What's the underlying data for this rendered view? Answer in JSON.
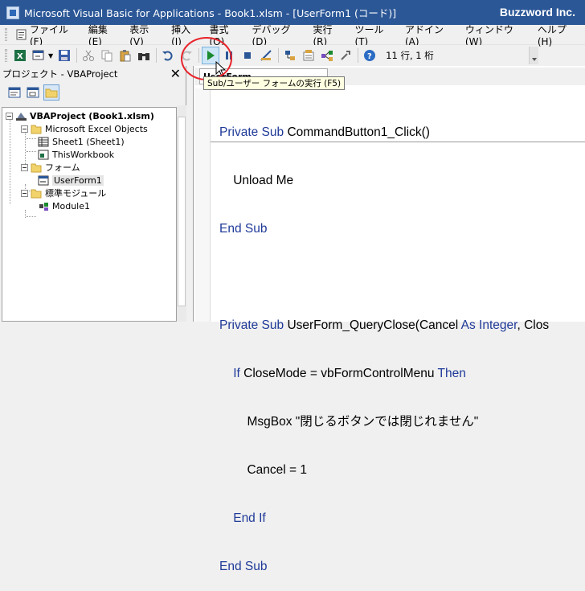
{
  "window": {
    "title": "Microsoft Visual Basic for Applications - Book1.xlsm - [UserForm1 (コード)]",
    "brand": "Buzzword Inc."
  },
  "menu": [
    {
      "label": "ファイル(F)",
      "icon": "vba-doc-icon"
    },
    {
      "label": "編集(E)",
      "icon": ""
    },
    {
      "label": "表示(V)",
      "icon": ""
    },
    {
      "label": "挿入(I)",
      "icon": ""
    },
    {
      "label": "書式(O)",
      "icon": ""
    },
    {
      "label": "デバッグ(D)",
      "icon": ""
    },
    {
      "label": "実行(R)",
      "icon": ""
    },
    {
      "label": "ツール(T)",
      "icon": ""
    },
    {
      "label": "アドイン(A)",
      "icon": ""
    },
    {
      "label": "ウィンドウ(W)",
      "icon": ""
    },
    {
      "label": "ヘルプ(H)",
      "icon": ""
    }
  ],
  "toolbar": {
    "position": "11 行, 1 桁",
    "run_tooltip": "Sub/ユーザー フォームの実行 (F5)"
  },
  "project_panel": {
    "title": "プロジェクト - VBAProject",
    "close": "✕",
    "tree": {
      "root": "VBAProject (Book1.xlsm)",
      "excel_objects": "Microsoft Excel Objects",
      "sheet1": "Sheet1 (Sheet1)",
      "thisworkbook": "ThisWorkbook",
      "forms": "フォーム",
      "userform1": "UserForm1",
      "modules": "標準モジュール",
      "module1": "Module1"
    }
  },
  "code_window": {
    "object_combo": "UserForm",
    "lines": {
      "l1_kw": "Private Sub",
      "l1_rest": " CommandButton1_Click()",
      "l2": "    Unload Me",
      "l3": "End Sub",
      "l5_kw": "Private Sub",
      "l5_rest": " UserForm_QueryClose(Cancel ",
      "l5_as": "As Integer",
      "l5_tail": ", Clos",
      "l6_if": "    If",
      "l6_mid": " CloseMode = vbFormControlMenu ",
      "l6_then": "Then",
      "l7": "        MsgBox \"閉じるボタンでは閉じれません\"",
      "l8": "        Cancel = 1",
      "l9": "    End If",
      "l10": "End Sub"
    }
  },
  "colors": {
    "titlebar": "#2b5797",
    "keyword": "#1f3a99",
    "highlight_circle": "#e8242b"
  }
}
